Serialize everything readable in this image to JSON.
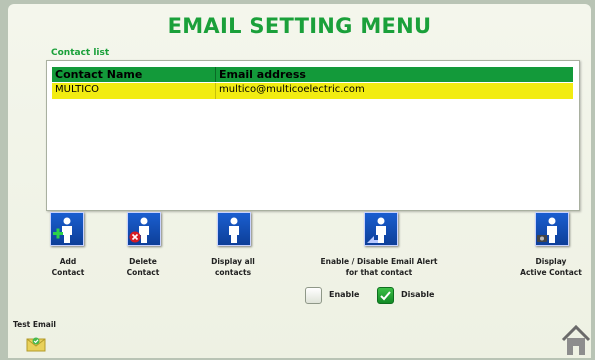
{
  "title": "EMAIL SETTING MENU",
  "contact_list": {
    "label": "Contact list",
    "headers": [
      "Contact Name",
      "Email address"
    ],
    "rows": [
      {
        "name": "MULTICO",
        "email": "multico@multicoelectric.com"
      }
    ]
  },
  "buttons": {
    "add": {
      "line1": "Add",
      "line2": "Contact"
    },
    "delete": {
      "line1": "Delete",
      "line2": "Contact"
    },
    "display_all": {
      "line1": "Display all",
      "line2": "contacts"
    },
    "enable_disable": {
      "line1": "Enable / Disable Email Alert",
      "line2": "for that contact"
    },
    "display_active": {
      "line1": "Display",
      "line2": "Active Contact"
    }
  },
  "checkboxes": {
    "enable": {
      "label": "Enable",
      "checked": false
    },
    "disable": {
      "label": "Disable",
      "checked": true
    }
  },
  "test_email": {
    "label": "Test Email"
  },
  "colors": {
    "accent": "#1aa03a",
    "header": "#139a3a",
    "highlight": "#f2ec11",
    "button": "#1a5ed0"
  }
}
